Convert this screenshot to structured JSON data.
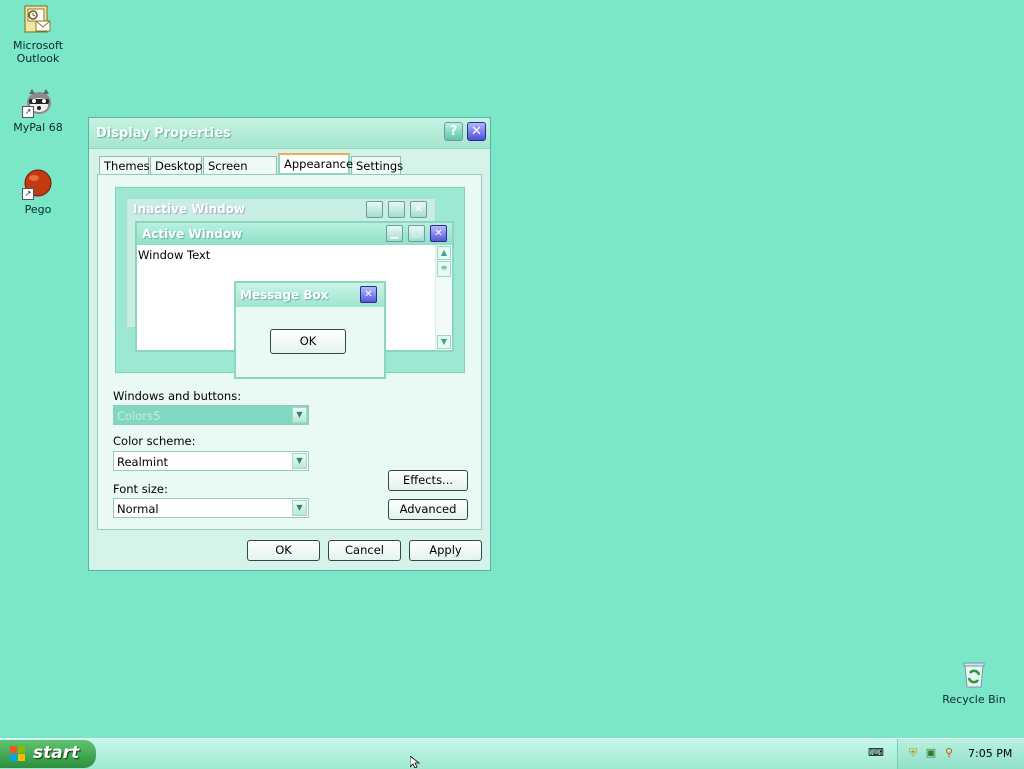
{
  "desktop": {
    "icons": [
      {
        "label_line1": "Microsoft",
        "label_line2": "Outlook",
        "icon": "outlook-icon"
      },
      {
        "label_line1": "MyPal 68",
        "icon": "raccoon-browser-icon"
      },
      {
        "label_line1": "Pego",
        "icon": "pego-ball-icon"
      }
    ],
    "recycle_bin": {
      "label": "Recycle Bin",
      "icon": "recycle-bin-icon"
    }
  },
  "window": {
    "title": "Display Properties",
    "help_glyph": "?",
    "close_glyph": "✕",
    "tabs": [
      "Themes",
      "Desktop",
      "Screen Saver",
      "Appearance",
      "Settings"
    ],
    "active_tab": "Appearance",
    "preview": {
      "inactive_title": "Inactive Window",
      "active_title": "Active Window",
      "window_text": "Window Text",
      "message_title": "Message Box",
      "message_ok": "OK"
    },
    "windows_buttons_label": "Windows and buttons:",
    "windows_buttons_value": "Colors5",
    "color_scheme_label": "Color scheme:",
    "color_scheme_value": "Realmint",
    "font_size_label": "Font size:",
    "font_size_value": "Normal",
    "effects_label": "Effects...",
    "advanced_label": "Advanced",
    "ok_label": "OK",
    "cancel_label": "Cancel",
    "apply_label": "Apply"
  },
  "taskbar": {
    "start_label": "start",
    "clock": "7:05 PM"
  }
}
